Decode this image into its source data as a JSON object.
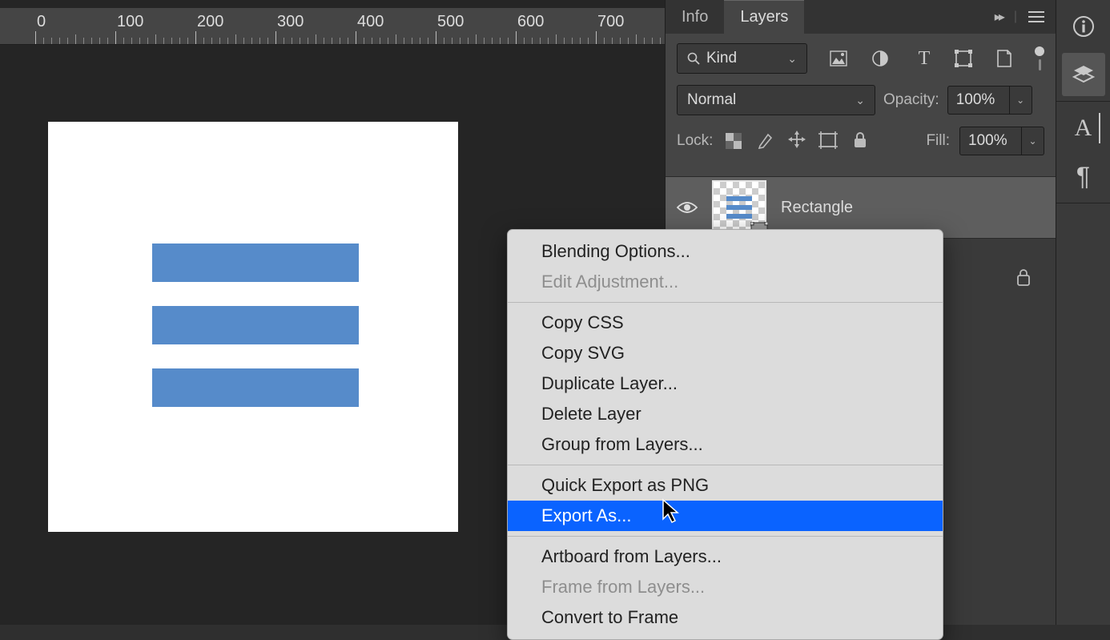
{
  "ruler": {
    "labels": [
      "0",
      "100",
      "200",
      "300",
      "400",
      "500",
      "600",
      "700"
    ]
  },
  "tabs": {
    "info": "Info",
    "layers": "Layers"
  },
  "layers_panel": {
    "filter_kind": "Kind",
    "blend_mode": "Normal",
    "opacity_label": "Opacity:",
    "opacity_value": "100%",
    "lock_label": "Lock:",
    "fill_label": "Fill:",
    "fill_value": "100%",
    "layer_name": "Rectangle"
  },
  "context_menu": {
    "groups": [
      [
        {
          "label": "Blending Options...",
          "disabled": false
        },
        {
          "label": "Edit Adjustment...",
          "disabled": true
        }
      ],
      [
        {
          "label": "Copy CSS",
          "disabled": false
        },
        {
          "label": "Copy SVG",
          "disabled": false
        },
        {
          "label": "Duplicate Layer...",
          "disabled": false
        },
        {
          "label": "Delete Layer",
          "disabled": false
        },
        {
          "label": "Group from Layers...",
          "disabled": false
        }
      ],
      [
        {
          "label": "Quick Export as PNG",
          "disabled": false
        },
        {
          "label": "Export As...",
          "disabled": false,
          "highlight": true
        }
      ],
      [
        {
          "label": "Artboard from Layers...",
          "disabled": false
        },
        {
          "label": "Frame from Layers...",
          "disabled": true
        },
        {
          "label": "Convert to Frame",
          "disabled": false
        }
      ]
    ]
  },
  "shape_color": "#568bca"
}
